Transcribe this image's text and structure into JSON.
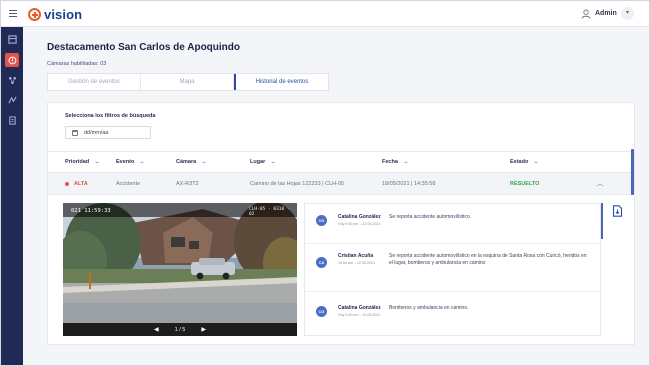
{
  "app": {
    "brand": "vision",
    "user": "Admin"
  },
  "sidebar": {
    "items": [
      "dashboard-icon",
      "alert-icon",
      "network-icon",
      "map-icon",
      "reports-icon"
    ],
    "active_index": 1
  },
  "page": {
    "title": "Destacamento San Carlos de Apoquindo",
    "subtitle": "Cámaras habilitadas: 03"
  },
  "tabs": [
    {
      "label": "Gestión de eventos",
      "active": false
    },
    {
      "label": "Mapa",
      "active": false
    },
    {
      "label": "Historial de eventos",
      "active": true
    }
  ],
  "filters": {
    "label": "Selecciona los filtros de búsqueda",
    "date_placeholder": "dd/mm/aa"
  },
  "table": {
    "headers": [
      "Prioridad",
      "Evento",
      "Cámara",
      "Lugar",
      "Fecha",
      "Estado"
    ],
    "rows": [
      {
        "priority": "ALTA",
        "event": "Accidente",
        "camera": "AX-R3T2",
        "place": "Camino de las Hojas 122233 | CLH-05",
        "date": "18/05/2021 | 14:35:58",
        "status": "RESUELTO"
      }
    ]
  },
  "media": {
    "timestamp": "021 11:59:33",
    "camera_label": "CLH-05 · 0310 · 02",
    "page": "1 / 5"
  },
  "comments": [
    {
      "initials": "CG",
      "author": "Catalina González",
      "date": "Hoy 5:40 pm – 12.06.2021",
      "text": "Se reporta accidente automovilístico."
    },
    {
      "initials": "CA",
      "author": "Cristian Acuña",
      "date": "10:54 am – 12.06.2021",
      "text": "Se reporta accidente automovilístico en la esquina de Santa Rosa con Curicó, heridos en el lugar, bomberos y ambulancia en camino"
    },
    {
      "initials": "CG",
      "author": "Catalina González",
      "date": "Hoy 5:40 pm – 12.06.2021",
      "text": "Bomberos y ambulancia en camino."
    }
  ],
  "colors": {
    "accent": "#2a4ca8",
    "sidebar": "#1f2b55",
    "danger": "#e2544a",
    "success": "#2fa84f",
    "brand_orange": "#f05a28"
  }
}
